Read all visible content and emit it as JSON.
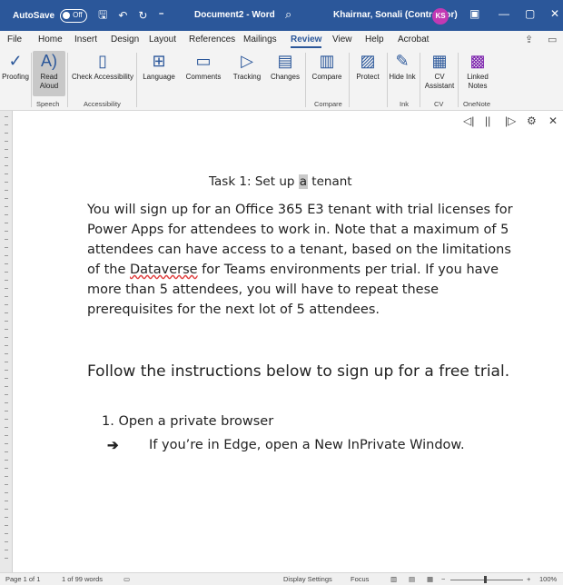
{
  "titlebar": {
    "autosave": "AutoSave",
    "toggle": "Off",
    "doc_title": "Document2 - Word",
    "user": "Khairnar, Sonali (Contractor)",
    "avatar": "KS"
  },
  "menu": {
    "tabs": [
      "File",
      "Home",
      "Insert",
      "Design",
      "Layout",
      "References",
      "Mailings",
      "Review",
      "View",
      "Help",
      "Acrobat"
    ],
    "active": "Review"
  },
  "ribbon": {
    "buttons": [
      "Proofing",
      "Read Aloud",
      "Check Accessibility",
      "Language",
      "Comments",
      "Tracking",
      "Changes",
      "Compare",
      "Protect",
      "Hide Ink",
      "CV Assistant",
      "Linked Notes"
    ],
    "groups": [
      "Speech",
      "Accessibility",
      "Compare",
      "Ink",
      "CV",
      "OneNote"
    ]
  },
  "document": {
    "title_before": "Task 1: Set up ",
    "title_highlight": "a",
    "title_after": " tenant",
    "para_a": "You will sign up for an Office 365 E3 tenant with trial licenses for Power Apps for attendees to work in. Note that a maximum of 5 attendees can have access to a tenant, based on the limitations of the ",
    "para_flagged": "Dataverse",
    "para_b": " for Teams environments per trial. If you have more than 5 attendees, you will have to repeat these prerequisites for the next lot of 5 attendees.",
    "para2": "Follow the instructions below to sign up for a free trial.",
    "list_item": "1. Open a private browser",
    "sub_item": "If you’re in Edge, open a New InPrivate Window."
  },
  "status": {
    "page": "Page 1 of 1",
    "words": "1 of 99 words",
    "display": "Display Settings",
    "focus": "Focus",
    "zoom": "100%"
  },
  "colors": {
    "accent": "#2b579a",
    "avatar": "#c239b3"
  }
}
